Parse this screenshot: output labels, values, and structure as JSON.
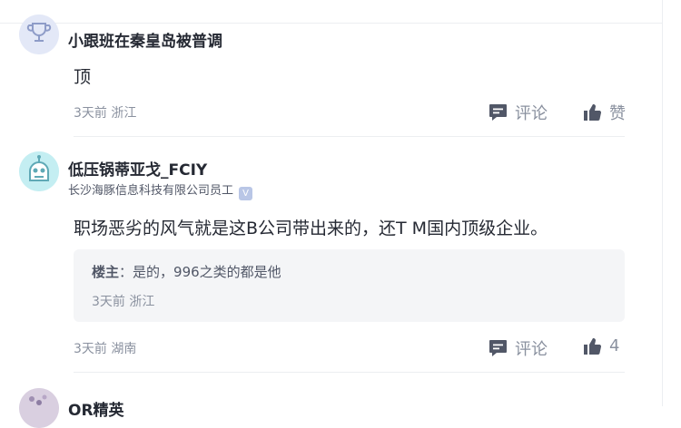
{
  "comments": [
    {
      "user_name": "小跟班在秦皇岛被普调",
      "content": "顶",
      "meta": "3天前 浙江",
      "comment_label": "评论",
      "like_label": "赞"
    },
    {
      "user_name": "低压锅蒂亚戈_FCIY",
      "user_title": "长沙海豚信息科技有限公司员工",
      "verify_glyph": "V",
      "content": "职场恶劣的风气就是这B公司带出来的，还T M国内顶级企业。",
      "reply": {
        "author_label": "楼主",
        "separator": "：",
        "text": "是的，996之类的都是他",
        "meta": "3天前 浙江"
      },
      "meta": "3天前 湖南",
      "comment_label": "评论",
      "like_count": "4"
    },
    {
      "user_name": "OR精英"
    }
  ],
  "colors": {
    "text_primary": "#252933",
    "text_secondary": "#8a919f",
    "reply_bg": "#f4f5f7",
    "divider": "#eceef1"
  }
}
